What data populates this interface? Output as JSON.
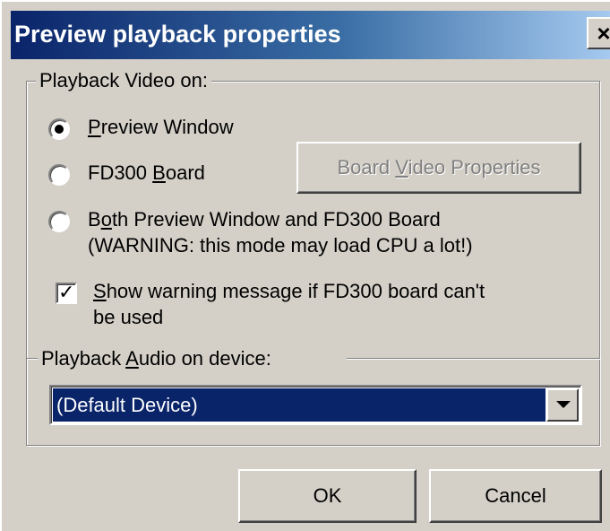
{
  "window": {
    "title": "Preview playback properties",
    "close_label": "×"
  },
  "video_group": {
    "legend": "Playback Video on:",
    "options": [
      {
        "label_pre": "",
        "label_key": "P",
        "label_post": "review Window",
        "selected": true
      },
      {
        "label_pre": "FD300 ",
        "label_key": "B",
        "label_post": "oard",
        "selected": false
      },
      {
        "label_pre": "B",
        "label_key": "o",
        "label_post": "th Preview Window and FD300 Board",
        "label_line2": "(WARNING: this mode may load CPU a lot!)",
        "selected": false
      }
    ],
    "board_props_button": {
      "pre": "Board ",
      "key": "V",
      "post": "ideo Properties",
      "enabled": false
    }
  },
  "warning_checkbox": {
    "checked": true,
    "label_key": "S",
    "label_post": "how warning message if FD300 board can't",
    "label_line2": "be used"
  },
  "audio": {
    "label_pre": "Playback ",
    "label_key": "A",
    "label_post": "udio on device:",
    "selected_device": "(Default Device)"
  },
  "buttons": {
    "ok": "OK",
    "cancel": "Cancel"
  }
}
